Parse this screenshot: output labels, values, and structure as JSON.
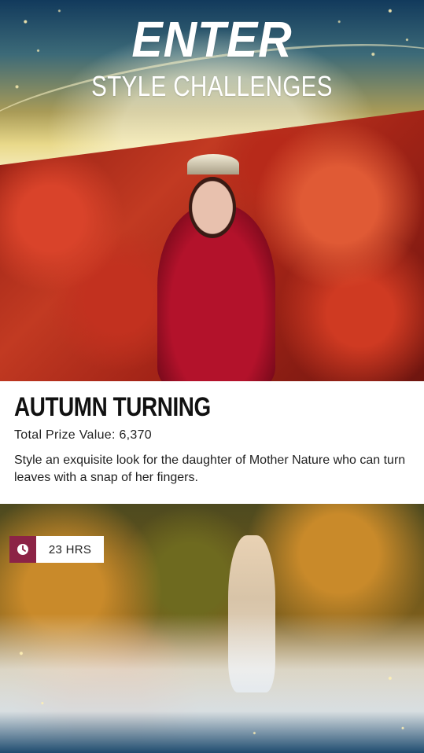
{
  "header": {
    "title": "ENTER",
    "subtitle": "STYLE CHALLENGES"
  },
  "challenge": {
    "title": "AUTUMN TURNING",
    "prize": "Total Prize Value: 6,370",
    "description": "Style an exquisite look for the daughter of Mother Nature who can turn leaves with a snap of her fingers."
  },
  "timer": {
    "icon": "clock-icon",
    "label": "23 HRS",
    "accent_color": "#8c2346"
  }
}
